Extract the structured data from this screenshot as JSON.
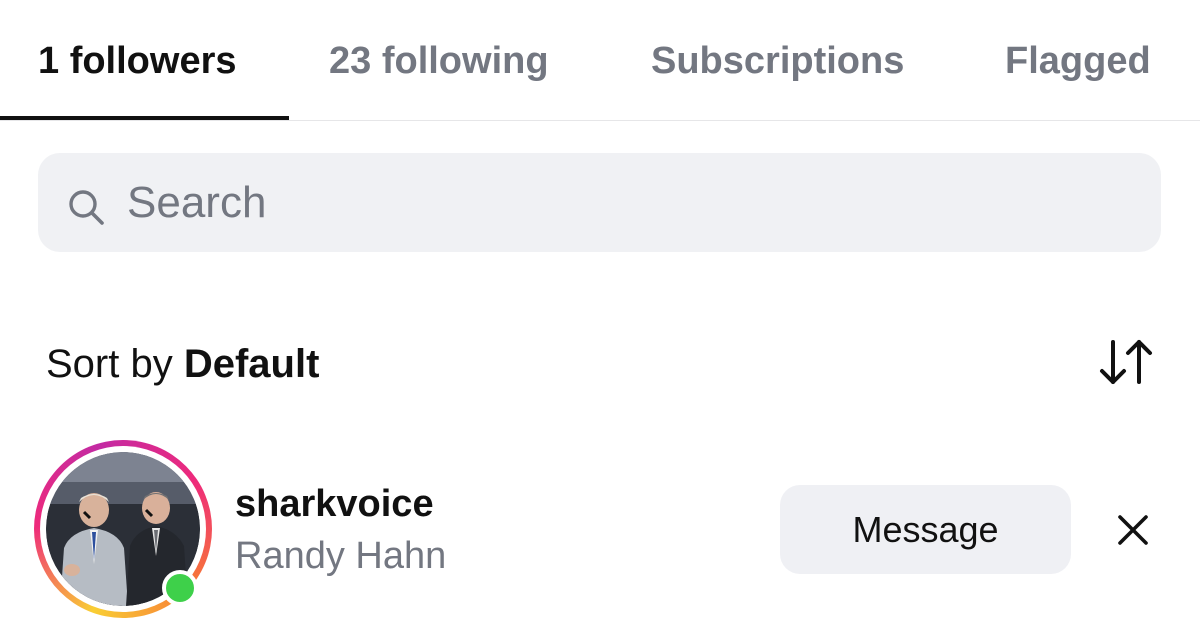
{
  "tabs": [
    {
      "label": "1 followers",
      "active": true
    },
    {
      "label": "23 following",
      "active": false
    },
    {
      "label": "Subscriptions",
      "active": false
    },
    {
      "label": "Flagged",
      "active": false
    }
  ],
  "search": {
    "placeholder": "Search",
    "value": "",
    "icon": "search-icon"
  },
  "sort": {
    "prefix": "Sort by",
    "value": "Default",
    "icon": "sort-arrows-icon"
  },
  "followers": [
    {
      "username": "sharkvoice",
      "full_name": "Randy Hahn",
      "online": true,
      "has_story_ring": true,
      "action_label": "Message",
      "remove_icon": "close-icon"
    }
  ],
  "colors": {
    "active_text": "#111111",
    "muted_text": "#737781",
    "search_bg": "#f0f1f4",
    "button_bg": "#eff0f4",
    "online": "#3ed04a",
    "story_ring": [
      "#f9ce34",
      "#ee2a7b",
      "#c32aa3"
    ]
  }
}
